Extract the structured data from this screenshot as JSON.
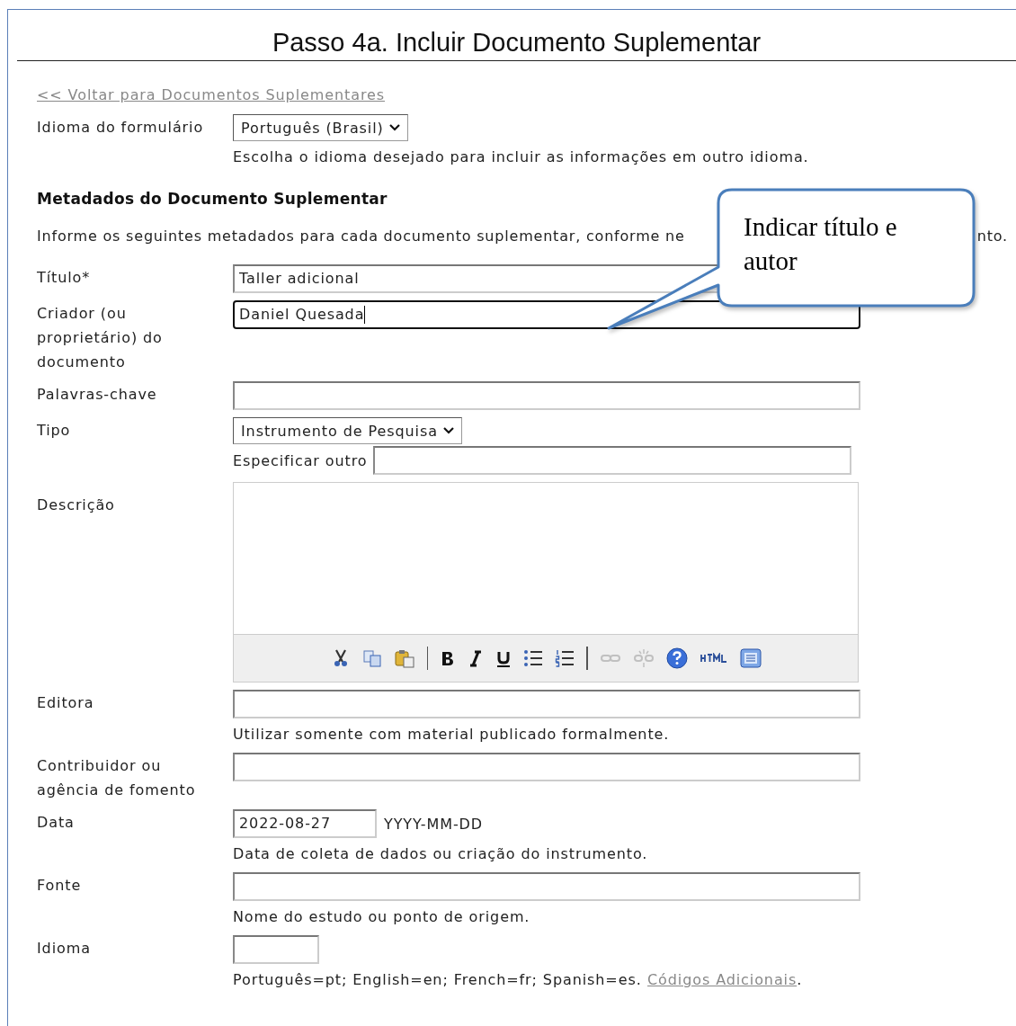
{
  "title": "Passo 4a. Incluir Documento Suplementar",
  "back_link": "<< Voltar para Documentos Suplementares",
  "form_language": {
    "label": "Idioma do formulário",
    "value": "Português (Brasil)",
    "hint": "Escolha o idioma desejado para incluir as informações em outro idioma."
  },
  "section": {
    "heading": "Metadados do Documento Suplementar",
    "intro_start": "Informe os seguintes metadados para cada documento suplementar, conforme ne",
    "intro_end": "nto."
  },
  "fields": [
    {
      "kind": "text",
      "label": "Título*",
      "value": "Taller adicional",
      "focused": false
    },
    {
      "kind": "text",
      "label": "Criador (ou proprietário) do documento",
      "value": "Daniel Quesada",
      "focused": true
    },
    {
      "kind": "text",
      "label": "Palavras-chave",
      "focused": false
    },
    {
      "kind": "select",
      "label": "Tipo",
      "value": "Instrumento de Pesquisa",
      "other_label": "Especificar outro",
      "focused": false
    },
    {
      "kind": "editor",
      "label": "Descrição",
      "focused": false,
      "toolbar": [
        {
          "kind": "cut",
          "disabled": false
        },
        {
          "kind": "copy",
          "disabled": false
        },
        {
          "kind": "paste",
          "disabled": false
        },
        {
          "kind": "separator",
          "disabled": false
        },
        {
          "kind": "bold",
          "disabled": false
        },
        {
          "kind": "italic",
          "disabled": false
        },
        {
          "kind": "underline",
          "disabled": false
        },
        {
          "kind": "bullets",
          "disabled": false
        },
        {
          "kind": "numbers",
          "disabled": false
        },
        {
          "kind": "separator",
          "disabled": false
        },
        {
          "kind": "link",
          "disabled": true
        },
        {
          "kind": "unlink",
          "disabled": true
        },
        {
          "kind": "help",
          "disabled": false
        },
        {
          "kind": "html",
          "disabled": false
        },
        {
          "kind": "fullscreen",
          "disabled": false
        }
      ]
    },
    {
      "kind": "text",
      "label": "Editora",
      "hint": "Utilizar somente com material publicado formalmente.",
      "focused": false
    },
    {
      "kind": "text",
      "label": "Contribuidor ou agência de fomento",
      "focused": false
    },
    {
      "kind": "date",
      "label": "Data",
      "value": "2022-08-27",
      "format": "YYYY-MM-DD",
      "hint": "Data de coleta de dados ou criação do instrumento.",
      "focused": false
    },
    {
      "kind": "text",
      "label": "Fonte",
      "hint": "Nome do estudo ou ponto de origem.",
      "focused": false
    },
    {
      "kind": "short",
      "label": "Idioma",
      "hint": "Português=pt; English=en; French=fr; Spanish=es.",
      "hint_link": "Códigos Adicionais",
      "hint_end": ".",
      "focused": false
    }
  ],
  "callout": {
    "text": "Indicar título e autor"
  }
}
